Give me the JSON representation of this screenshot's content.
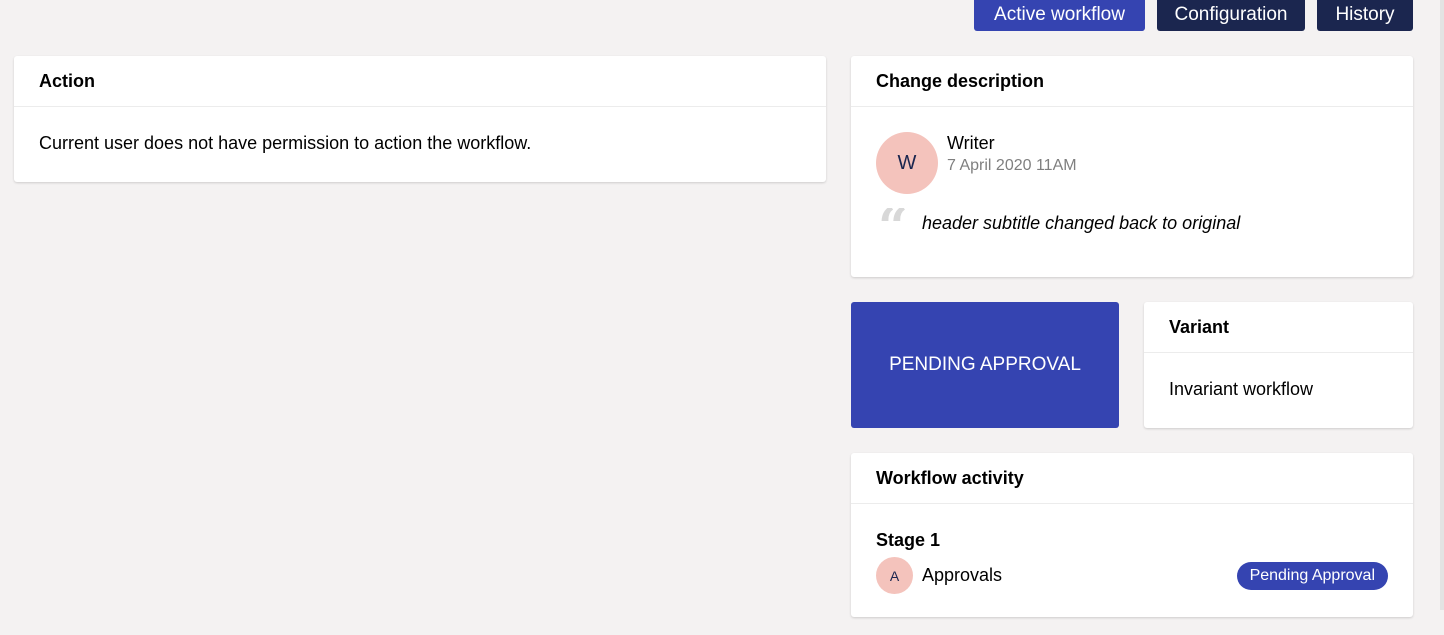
{
  "tabs": {
    "active_workflow": "Active workflow",
    "configuration": "Configuration",
    "history": "History"
  },
  "action": {
    "title": "Action",
    "message": "Current user does not have permission to action the workflow."
  },
  "change_description": {
    "title": "Change description",
    "author_initial": "W",
    "author_name": "Writer",
    "date": "7 April 2020 11AM",
    "quote": "header subtitle changed back to original"
  },
  "state": {
    "label": "PENDING APPROVAL"
  },
  "variant": {
    "title": "Variant",
    "value": "Invariant workflow"
  },
  "activity": {
    "title": "Workflow activity",
    "stage_title": "Stage 1",
    "group_initial": "A",
    "group_name": "Approvals",
    "status": "Pending Approval"
  },
  "colors": {
    "primary": "#3544b1",
    "dark": "#1b264f",
    "avatar": "#f4c3bc",
    "background": "#f4f2f2"
  },
  "icons": {
    "quote": "quote-icon"
  }
}
